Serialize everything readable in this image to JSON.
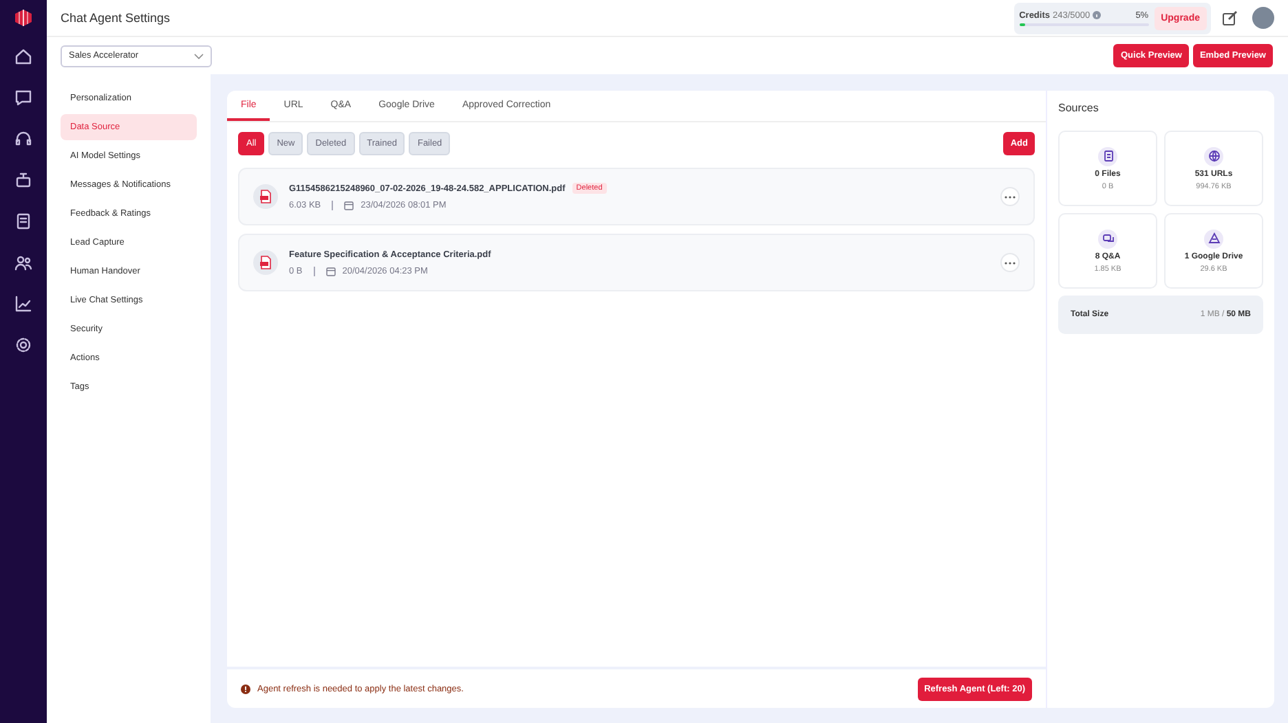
{
  "header": {
    "title": "Chat Agent Settings",
    "credits": {
      "label": "Credits",
      "value": "243/5000",
      "percent": "5%",
      "level": 0.05
    },
    "upgrade": "Upgrade"
  },
  "agent_select": {
    "value": "Sales Accelerator"
  },
  "actions": [
    "Quick Preview",
    "Embed Preview"
  ],
  "settings_menu": [
    {
      "label": "Personalization",
      "selected": false
    },
    {
      "label": "Data Source",
      "selected": true
    },
    {
      "label": "AI Model Settings",
      "selected": false
    },
    {
      "label": "Messages & Notifications",
      "selected": false
    },
    {
      "label": "Feedback & Ratings",
      "selected": false
    },
    {
      "label": "Lead Capture",
      "selected": false
    },
    {
      "label": "Human Handover",
      "selected": false
    },
    {
      "label": "Live Chat Settings",
      "selected": false
    },
    {
      "label": "Security",
      "selected": false
    },
    {
      "label": "Actions",
      "selected": false
    },
    {
      "label": "Tags",
      "selected": false
    }
  ],
  "tabs": [
    {
      "label": "File",
      "selected": true
    },
    {
      "label": "URL",
      "selected": false
    },
    {
      "label": "Q&A",
      "selected": false
    },
    {
      "label": "Google Drive",
      "selected": false
    },
    {
      "label": "Approved Correction",
      "selected": false
    }
  ],
  "filters": [
    {
      "label": "All",
      "selected": true
    },
    {
      "label": "New",
      "selected": false
    },
    {
      "label": "Deleted",
      "selected": false
    },
    {
      "label": "Trained",
      "selected": false
    },
    {
      "label": "Failed",
      "selected": false
    }
  ],
  "add_button": "Add",
  "files": [
    {
      "name": "G1154586215248960_07-02-2026_19-48-24.582_APPLICATION.pdf",
      "badge": "Deleted",
      "size": "6.03 KB",
      "date": "23/04/2026 08:01 PM"
    },
    {
      "name": "Feature Specification & Acceptance Criteria.pdf",
      "size": "0 B",
      "date": "20/04/2026 04:23 PM"
    }
  ],
  "notice": {
    "text": "Agent refresh is needed to apply the latest changes.",
    "button": "Refresh Agent (Left: 20)"
  },
  "sources": {
    "title": "Sources",
    "cards": [
      {
        "kind": "files",
        "count": "0 Files",
        "size": "0 B"
      },
      {
        "kind": "urls",
        "count": "531 URLs",
        "size": "994.76 KB"
      },
      {
        "kind": "qa",
        "count": "8 Q&A",
        "size": "1.85 KB"
      },
      {
        "kind": "drive",
        "count": "1 Google Drive",
        "size": "29.6 KB"
      }
    ],
    "total_label": "Total Size",
    "total_value": "1 MB / **50 MB**"
  }
}
